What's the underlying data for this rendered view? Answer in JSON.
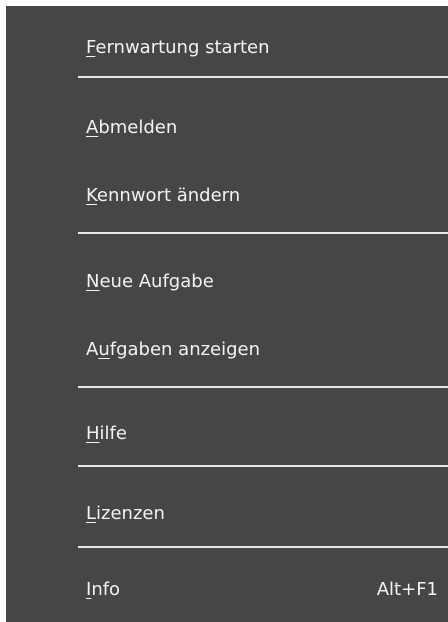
{
  "menu": {
    "items": [
      {
        "pre": "",
        "key": "F",
        "post": "ernwartung starten",
        "shortcut": ""
      },
      {
        "pre": "",
        "key": "A",
        "post": "bmelden",
        "shortcut": ""
      },
      {
        "pre": "",
        "key": "K",
        "post": "ennwort ändern",
        "shortcut": ""
      },
      {
        "pre": "",
        "key": "N",
        "post": "eue Aufgabe",
        "shortcut": ""
      },
      {
        "pre": "A",
        "key": "u",
        "post": "fgaben anzeigen",
        "shortcut": ""
      },
      {
        "pre": "",
        "key": "H",
        "post": "ilfe",
        "shortcut": ""
      },
      {
        "pre": "",
        "key": "L",
        "post": "izenzen",
        "shortcut": ""
      },
      {
        "pre": "",
        "key": "I",
        "post": "nfo",
        "shortcut": "Alt+F1"
      }
    ]
  }
}
